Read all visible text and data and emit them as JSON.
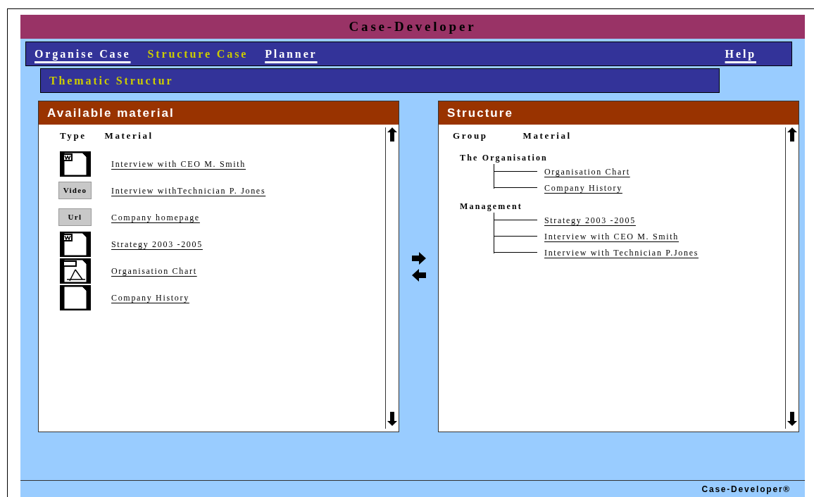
{
  "window": {
    "title": "Case-Developer"
  },
  "menu": [
    {
      "label": "Organise Case",
      "selected": false
    },
    {
      "label": "Structure Case",
      "selected": true
    },
    {
      "label": "Planner",
      "selected": false
    }
  ],
  "help": "Help",
  "section_title": "Thematic Structur",
  "available": {
    "title": "Available material",
    "columns": [
      "Type",
      "Material"
    ],
    "items": [
      {
        "kind": "word",
        "label": "Interview with CEO M. Smith"
      },
      {
        "kind": "video",
        "badge": "Video",
        "label": "Interview withTechnician P. Jones"
      },
      {
        "kind": "url",
        "badge": "Url",
        "label": "Company homepage"
      },
      {
        "kind": "word",
        "label": "Strategy 2003 -2005"
      },
      {
        "kind": "pdf",
        "label": "Organisation Chart"
      },
      {
        "kind": "file",
        "label": "Company History"
      }
    ]
  },
  "structure": {
    "title": "Structure",
    "columns": [
      "Group",
      "Material"
    ],
    "groups": [
      {
        "label": "The Organisation",
        "children": [
          "Organisation Chart",
          "Company History"
        ]
      },
      {
        "label": "Management",
        "children": [
          "Strategy 2003 -2005",
          "Interview with CEO M. Smith",
          "Interview with Technician P.Jones"
        ]
      }
    ]
  },
  "footer": "Case-Developer®"
}
